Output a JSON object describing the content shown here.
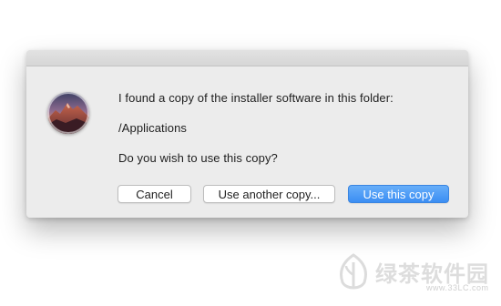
{
  "dialog": {
    "message_line1": "I found a copy of the installer software in this folder:",
    "folder_path": "/Applications",
    "question": "Do you wish to use this copy?",
    "icon": "macos-sierra-installer-icon"
  },
  "buttons": {
    "cancel_label": "Cancel",
    "use_another_label": "Use another copy...",
    "use_this_label": "Use this copy"
  },
  "watermark": {
    "logo_text": "绿茶软件园",
    "url": "www.33LC.com"
  },
  "colors": {
    "dialog_bg": "#ececec",
    "default_button": "#3b8ef3",
    "text": "#1e1e1e"
  }
}
